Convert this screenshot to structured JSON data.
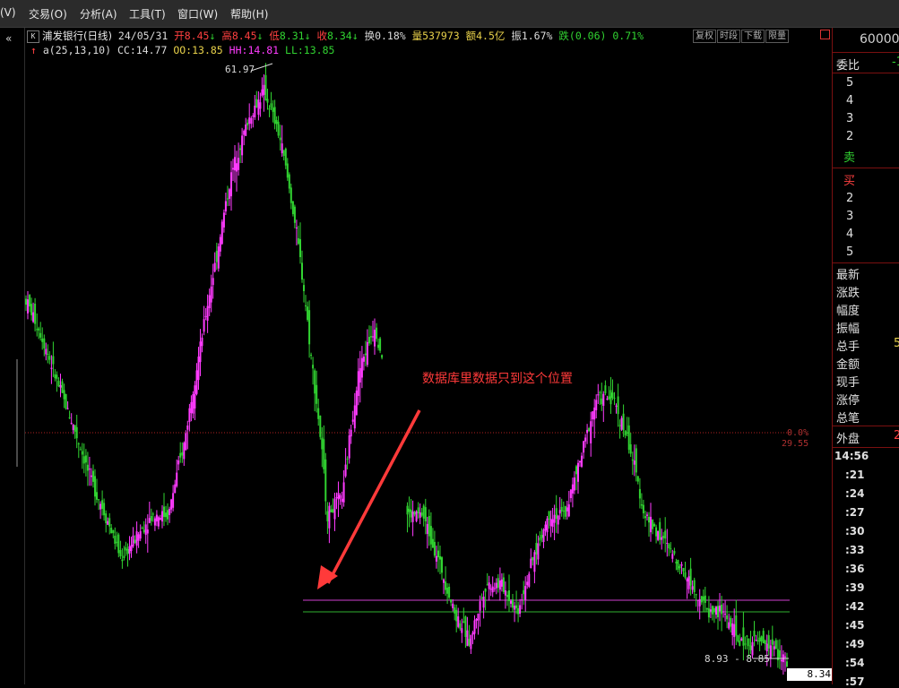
{
  "menu": [
    "(V)",
    "交易(O)",
    "分析(A)",
    "工具(T)",
    "窗口(W)",
    "帮助(H)"
  ],
  "left_strip": {
    "collapse_glyph": "«"
  },
  "chart_header": {
    "k_icon": "K",
    "stock_name": "浦发银行(日线)",
    "date": "24/05/31",
    "open_label": "开",
    "open": "8.45",
    "open_arrow": "↓",
    "high_label": "高",
    "high": "8.45",
    "high_arrow": "↓",
    "low_label": "低",
    "low": "8.31",
    "low_arrow": "↓",
    "close_label": "收",
    "close": "8.34",
    "close_arrow": "↓",
    "turnover_label": "换",
    "turnover": "0.18%",
    "volume_label": "量",
    "volume": "537973",
    "amount_label": "额",
    "amount": "4.5亿",
    "amplitude_label": "振",
    "amplitude": "1.67%",
    "change_label": "跌",
    "change": "(0.06)",
    "change_pct": "0.71%"
  },
  "indicator": {
    "arrow": "↑",
    "name": "a(25,13,10)",
    "cc_label": "CC:",
    "cc": "14.77",
    "oo_label": "OO:",
    "oo": "13.85",
    "hh_label": "HH:",
    "hh": "14.81",
    "ll_label": "LL:",
    "ll": "13.85"
  },
  "toolbar": {
    "buttons": [
      "复权",
      "时段",
      "下载",
      "限量"
    ]
  },
  "annotation": {
    "text": "数据库里数据只到这个位置",
    "color": "#ff3a3a"
  },
  "labels": {
    "peak": "61.97",
    "range": "8.93 - 8.85",
    "pct_top": "0.0%",
    "pct_bottom": "29.55",
    "current": "8.34"
  },
  "right_panel": {
    "code": "60000",
    "commission_label": "委比",
    "commission_value": "-1",
    "sell_levels": [
      "5",
      "4",
      "3",
      "2",
      "卖"
    ],
    "buy_levels": [
      "买",
      "2",
      "3",
      "4",
      "5"
    ],
    "stats": [
      "最新",
      "涨跌",
      "幅度",
      "振幅",
      "总手",
      "金额",
      "现手",
      "涨停",
      "总笔"
    ],
    "stats_partial_value": "5",
    "outer_label": "外盘",
    "outer_value": "2",
    "times": [
      "14:56",
      ":21",
      ":24",
      ":27",
      ":30",
      ":33",
      ":36",
      ":39",
      ":42",
      ":45",
      ":49",
      ":54",
      ":57"
    ]
  },
  "colors": {
    "up": "#ff3bff",
    "down": "#31d331",
    "ref_red": "#b02020",
    "hline_magenta": "#d040d0",
    "hline_green": "#2fb02f",
    "panel_border": "#7a1010"
  },
  "chart_data": {
    "type": "candlestick",
    "title": "浦发银行(日线)",
    "last_date": "24/05/31",
    "last_close": 8.34,
    "peak_high": 61.97,
    "range_label_values": [
      8.93,
      8.85
    ],
    "reference_line_pct": "0.0%",
    "horizontal_lines": [
      {
        "name": "HH",
        "value": 14.81
      },
      {
        "name": "LL",
        "value": 13.85
      }
    ],
    "price_path_approx": [
      29.5,
      26,
      22,
      19,
      16,
      14,
      12,
      13,
      14,
      14,
      18,
      25,
      34,
      46,
      55,
      61,
      52,
      38,
      24,
      14,
      15,
      23,
      27,
      21,
      14,
      14,
      12,
      10,
      9,
      11,
      11,
      10,
      12,
      14,
      14,
      17,
      21,
      21,
      18,
      14,
      13,
      12,
      11,
      10,
      10,
      9,
      9,
      8.9,
      8.34
    ]
  }
}
